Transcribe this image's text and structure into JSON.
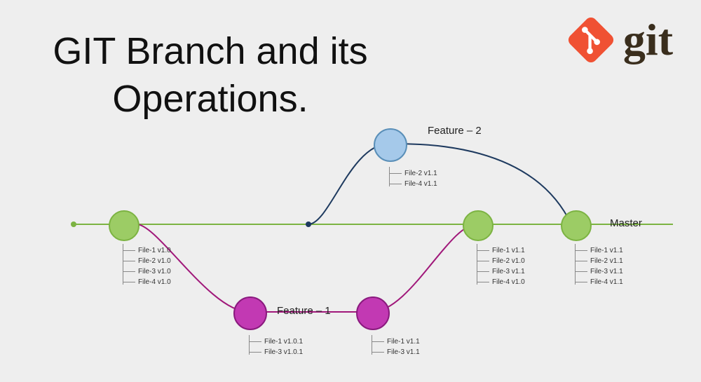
{
  "title": "GIT Branch and its Operations.",
  "logo": {
    "text": "git",
    "color_diamond": "#f05133",
    "color_branch": "#ffffff"
  },
  "branches": {
    "master": {
      "label": "Master",
      "color_line": "#7cb342",
      "color_node": "#9ccc65"
    },
    "feature1": {
      "label": "Feature – 1",
      "color_line": "#a0187a",
      "color_node": "#c239b3"
    },
    "feature2": {
      "label": "Feature – 2",
      "color_line": "#1e3a5f",
      "color_node": "#a5c9ea"
    }
  },
  "file_lists": {
    "commit_master_1": [
      "File-1 v1.0",
      "File-2 v1.0",
      "File-3 v1.0",
      "File-4 v1.0"
    ],
    "commit_feature2": [
      "File-2 v1.1",
      "File-4 v1.1"
    ],
    "commit_master_merge_f2": [
      "File-1 v1.1",
      "File-2 v1.0",
      "File-3 v1.1",
      "File-4 v1.0"
    ],
    "commit_master_final": [
      "File-1 v1.1",
      "File-2 v1.1",
      "File-3 v1.1",
      "File-4 v1.1"
    ],
    "commit_feature1_a": [
      "File-1 v1.0.1",
      "File-3 v1.0.1"
    ],
    "commit_feature1_b": [
      "File-1 v1.1",
      "File-3 v1.1"
    ]
  },
  "colors": {
    "bg": "#eeeeee",
    "text": "#111111"
  }
}
